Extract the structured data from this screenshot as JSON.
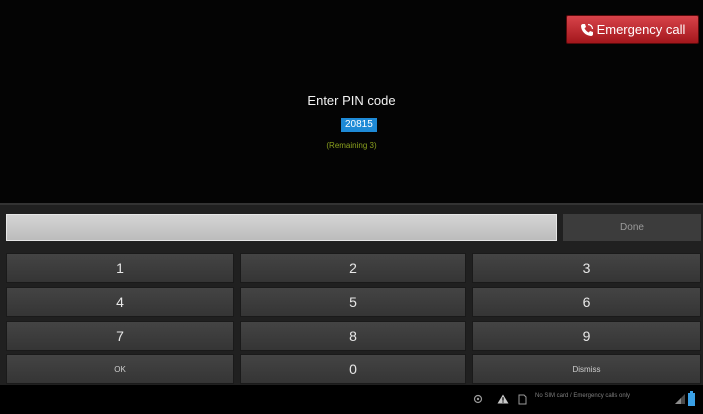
{
  "lockscreen": {
    "emergency_label": "Emergency call",
    "title": "Enter PIN code",
    "pin_value": "20815",
    "remaining": "(Remaining 3)"
  },
  "keypad": {
    "done_label": "Done",
    "keys": [
      "1",
      "2",
      "3",
      "4",
      "5",
      "6",
      "7",
      "8",
      "9",
      "OK",
      "0",
      "Dismiss"
    ]
  },
  "statusbar": {
    "text": "No SIM card / Emergency calls only"
  },
  "icons": [
    "phone-icon",
    "location-icon",
    "warning-icon",
    "sim-icon",
    "signal-icon",
    "battery-icon"
  ],
  "colors": {
    "emergency": "#c0272d",
    "pin_highlight": "#1e8ad6",
    "remaining_text": "#8aa01e",
    "battery": "#3aa0e6"
  }
}
